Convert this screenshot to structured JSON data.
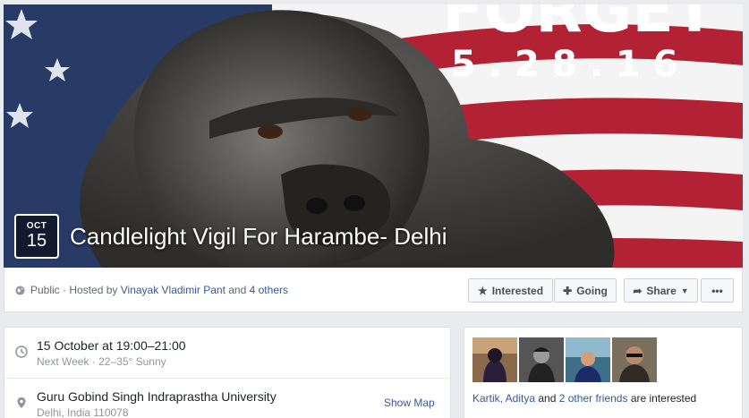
{
  "cover": {
    "banner_word": "FORGET",
    "banner_date": "5.28.16",
    "date_month": "OCT",
    "date_day": "15",
    "title": "Candlelight Vigil For Harambe- Delhi"
  },
  "info_bar": {
    "privacy": "Public",
    "hosted_prefix": "· Hosted by",
    "host_name": "Vinayak Vladimir Pant",
    "and": "and",
    "others": "4 others",
    "interested_label": "Interested",
    "going_label": "Going",
    "share_label": "Share",
    "more_label": "•••"
  },
  "details": {
    "time_primary": "15 October at 19:00–21:00",
    "time_secondary": "Next Week · 22–35° Sunny",
    "location_primary": "Guru Gobind Singh Indraprastha University",
    "location_secondary": "Delhi, India 110078",
    "show_map": "Show Map"
  },
  "friends": {
    "names_link": "Kartik, Aditya",
    "and": "and",
    "others_link": "2 other friends",
    "suffix": "are interested"
  },
  "colors": {
    "link": "#365899",
    "page_bg": "#e9ebee",
    "flag_red": "#b22234",
    "flag_blue": "#283a66"
  }
}
